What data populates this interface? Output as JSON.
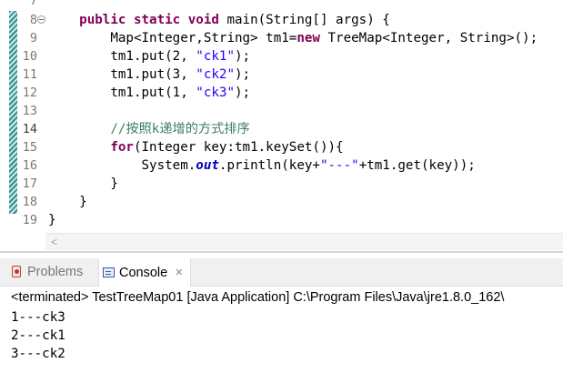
{
  "editor": {
    "partial_top_line_number": "7",
    "lines": [
      {
        "num": "8",
        "fold": true,
        "tokens": [
          {
            "t": "    "
          },
          {
            "t": "public static void",
            "c": "kw"
          },
          {
            "t": " main(String[] args) {"
          }
        ]
      },
      {
        "num": "9",
        "tokens": [
          {
            "t": "        Map<Integer,String> tm1="
          },
          {
            "t": "new",
            "c": "kw"
          },
          {
            "t": " TreeMap<Integer, String>();"
          }
        ]
      },
      {
        "num": "10",
        "tokens": [
          {
            "t": "        tm1.put(2, "
          },
          {
            "t": "\"ck1\"",
            "c": "str"
          },
          {
            "t": ");"
          }
        ]
      },
      {
        "num": "11",
        "tokens": [
          {
            "t": "        tm1.put(3, "
          },
          {
            "t": "\"ck2\"",
            "c": "str"
          },
          {
            "t": ");"
          }
        ]
      },
      {
        "num": "12",
        "tokens": [
          {
            "t": "        tm1.put(1, "
          },
          {
            "t": "\"ck3\"",
            "c": "str"
          },
          {
            "t": ");"
          }
        ]
      },
      {
        "num": "13",
        "tokens": [
          {
            "t": ""
          }
        ]
      },
      {
        "num": "14",
        "current": true,
        "tokens": [
          {
            "t": "        "
          },
          {
            "t": "//按照k递增的方式排序",
            "c": "cm"
          }
        ]
      },
      {
        "num": "15",
        "tokens": [
          {
            "t": "        "
          },
          {
            "t": "for",
            "c": "kw"
          },
          {
            "t": "(Integer key:tm1.keySet()){"
          }
        ]
      },
      {
        "num": "16",
        "tokens": [
          {
            "t": "            System."
          },
          {
            "t": "out",
            "c": "sf"
          },
          {
            "t": ".println(key+"
          },
          {
            "t": "\"---\"",
            "c": "str"
          },
          {
            "t": "+tm1.get(key));"
          }
        ]
      },
      {
        "num": "17",
        "tokens": [
          {
            "t": "        }"
          }
        ]
      },
      {
        "num": "18",
        "tokens": [
          {
            "t": "    }"
          }
        ]
      },
      {
        "num": "19",
        "tokens": [
          {
            "t": "}"
          }
        ]
      }
    ],
    "scroll_left_glyph": "<"
  },
  "views": {
    "tabs": {
      "problems": {
        "label": "Problems",
        "icon": "problems-icon"
      },
      "console": {
        "label": "Console",
        "icon": "console-icon",
        "close_glyph": "✕"
      }
    },
    "console": {
      "status": "<terminated> TestTreeMap01 [Java Application] C:\\Program Files\\Java\\jre1.8.0_162\\",
      "output": [
        "1---ck3",
        "2---ck1",
        "3---ck2"
      ]
    }
  },
  "colors": {
    "keyword": "#7f0055",
    "string": "#2a00ff",
    "comment": "#3f7f5f",
    "static_field": "#0000c0"
  }
}
